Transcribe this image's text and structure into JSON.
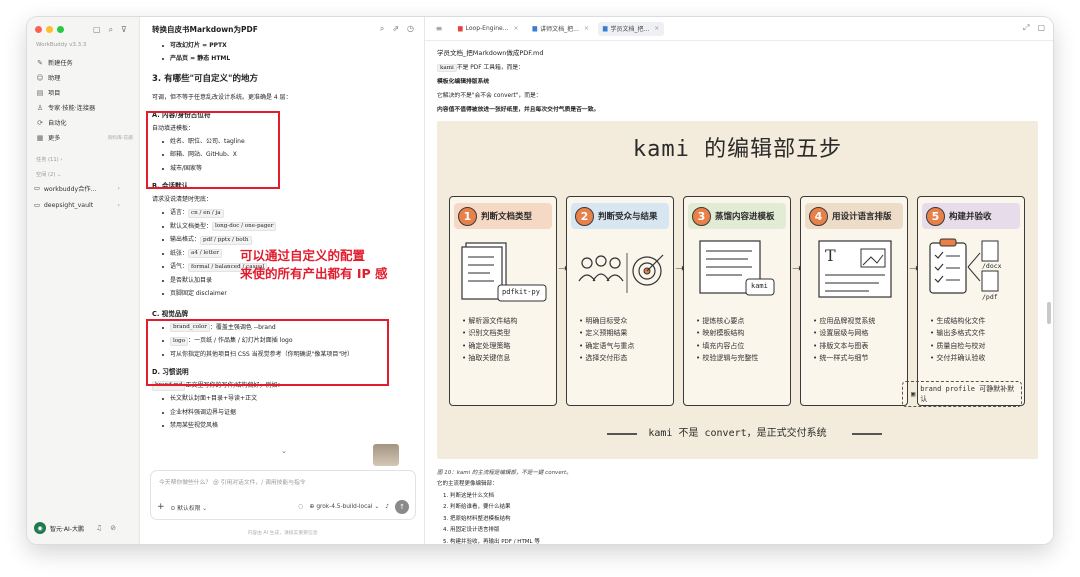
{
  "sidebar": {
    "app_name": "WorkBuddy v3.3.3",
    "menu": [
      {
        "icon": "✎",
        "label": "新建任务",
        "extra": ""
      },
      {
        "icon": "☺",
        "label": "助理",
        "extra": ""
      },
      {
        "icon": "▤",
        "label": "项目",
        "extra": ""
      },
      {
        "icon": "♙",
        "label": "专家·技能·连接器",
        "extra": ""
      },
      {
        "icon": "⟳",
        "label": "自动化",
        "extra": ""
      },
      {
        "icon": "▦",
        "label": "更多",
        "extra": "资料库·花廊"
      }
    ],
    "tasks_label": "任务 (11)",
    "spaces_label": "空间 (2)",
    "projects": [
      {
        "label": "workbuddy合作..."
      },
      {
        "label": "deepsight_vault"
      }
    ],
    "user_name": "智元·AI-大鹏"
  },
  "chat": {
    "title": "转换自皮书Markdown为PDF",
    "lines_top": [
      "可改幻灯片 = PPTX",
      "产品页 = 静态 HTML"
    ],
    "section_title": "3. 有哪些\"可自定义\"的地方",
    "intro": "可调，但不等于任意乱改设计系统。更准确是 4 层：",
    "a_title": "A. 内容/身份占位符",
    "a_sub": "自动填进模板：",
    "a_items": [
      "姓名、职位、公司、tagline",
      "邮箱、网站、GitHub、X",
      "城市/国家等"
    ],
    "b_title": "B. 会话默认",
    "b_sub": "请求没说清楚时兜底：",
    "b_items": [
      {
        "label": "语言：",
        "code": "cn / en / ja",
        "after": ""
      },
      {
        "label": "默认文档类型：",
        "code": "long-doc / one-pager",
        "after": ""
      },
      {
        "label": "输出格式：",
        "code": "pdf / pptx / both",
        "after": ""
      },
      {
        "label": "纸张：",
        "code": "a4 / letter",
        "after": ""
      },
      {
        "label": "语气：",
        "code": "formal / balanced / casual",
        "after": ""
      },
      {
        "label": "是否默认加目录",
        "code": "",
        "after": ""
      },
      {
        "label": "页脚固定 disclaimer",
        "code": "",
        "after": ""
      }
    ],
    "c_title": "C. 视觉品牌",
    "c_items": [
      {
        "label": "",
        "code": "brand_color",
        "after": "：覆盖主强调色 --brand"
      },
      {
        "label": "",
        "code": "logo",
        "after": "：一页纸 / 作品集 / 幻灯片封面插 logo"
      },
      {
        "label": "可从你指定的其他项目扫 CSS 当视觉参考（你明确说\"像某项目\"时）",
        "code": "",
        "after": ""
      }
    ],
    "d_title": "D. 习惯说明",
    "d_sub_code": "brand.md",
    "d_sub_after": " 正文里写你的写作/结构偏好，例如：",
    "d_items": [
      "长文默认封面+目录+导读+正文",
      "企业材料强调边界与证据",
      "禁用某些视觉风格"
    ],
    "overlay_line1": "可以通过自定义的配置",
    "overlay_line2": "来使的所有产出都有 IP 感",
    "input_placeholder": "今天帮你做些什么？ @ 引用对话文件，/ 调用技能与指令",
    "permission_label": "默认权限",
    "model_label": "grok-4.5-build-local",
    "footnote": "内容由 AI 生成，请核实重要信息"
  },
  "doc": {
    "tabs": [
      {
        "label": "Loop-Engine...",
        "active": false,
        "color": "#e0443c"
      },
      {
        "label": "讲师文档_把...",
        "active": false,
        "color": "#3a7bd5"
      },
      {
        "label": "学员文档_把...",
        "active": true,
        "color": "#3a7bd5"
      }
    ],
    "title": "学员文档_把Markdown做成PDF.md",
    "line1_code": "kami",
    "line1_after": " 不是 PDF 工具箱，而是：",
    "line2": "模板化编辑排版系统",
    "line3": "它解决的不是\"会不会 convert\"，而是：",
    "line4": "内容值不值得被放进一张好纸里，并且每次交付气质是否一致。",
    "caption": "图 10：kami 的主流程是编辑部，不是一键 convert。",
    "after_title": "它的主流程更像编辑部：",
    "after_items": [
      "1. 判断这是什么文档",
      "2. 判断给谁看，要什么结果",
      "3. 把原始材料整进模板结构",
      "4. 用固定设计语言排版",
      "5. 构建并验收，再输出 PDF / HTML 等"
    ]
  },
  "poster": {
    "title": "kami 的编辑部五步",
    "steps": [
      {
        "num": "1",
        "title": "判断文档类型",
        "tag": "pdfkit-py",
        "items": [
          "解析源文件结构",
          "识别文档类型",
          "确定处理策略",
          "抽取关键信息"
        ]
      },
      {
        "num": "2",
        "title": "判断受众与结果",
        "tag": "",
        "items": [
          "明确目标受众",
          "定义预期结果",
          "确定语气与重点",
          "选择交付形态"
        ]
      },
      {
        "num": "3",
        "title": "蒸馏内容进模板",
        "tag": "kami",
        "items": [
          "提炼核心要点",
          "映射模板结构",
          "填充内容占位",
          "校验逻辑与完整性"
        ]
      },
      {
        "num": "4",
        "title": "用设计语言排版",
        "tag": "",
        "items": [
          "应用品牌视觉系统",
          "设置层级与网格",
          "排版文本与图表",
          "统一样式与细节"
        ]
      },
      {
        "num": "5",
        "title": "构建并验收",
        "tag": "",
        "items": [
          "生成结构化文件",
          "输出多格式文件",
          "质量自检与校对",
          "交付并确认验收"
        ],
        "outputs": [
          "/docx",
          "/pdf"
        ]
      }
    ],
    "brand_label": "brand profile 可静默补默认",
    "footer": "kami 不是 convert，是正式交付系统",
    "accent": "#e8804a",
    "bg": "#f3ecdd",
    "header_colors": [
      "#f6d9c4",
      "#d8e6f1",
      "#e2ebd4",
      "#eddcc8",
      "#e7dce9"
    ]
  }
}
